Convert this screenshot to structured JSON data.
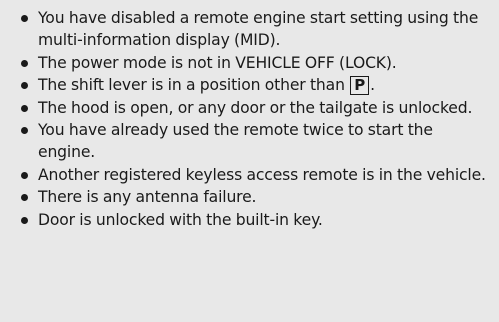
{
  "conditions": [
    {
      "text": "You have disabled a remote engine start setting using the multi-information display (MID)."
    },
    {
      "text": "The power mode is not in VEHICLE OFF (LOCK)."
    },
    {
      "text": "The shift lever is in a position other than",
      "gear": "P",
      "after": "."
    },
    {
      "text": "The hood is open, or any door or the tailgate is unlocked."
    },
    {
      "text": "You have already used the remote twice to start the engine."
    },
    {
      "text": "Another registered keyless access remote is in the vehicle."
    },
    {
      "text": "There is any antenna failure."
    },
    {
      "text": "Door is unlocked with the built-in key."
    }
  ]
}
